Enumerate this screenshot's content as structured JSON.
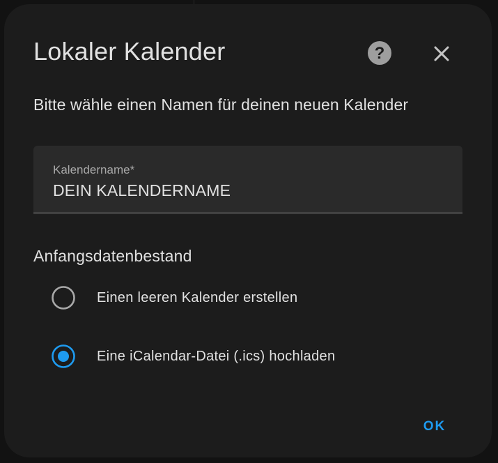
{
  "dialog": {
    "title": "Lokaler Kalender",
    "subtitle": "Bitte wähle einen Namen für deinen neuen Kalender",
    "help_icon": "help-circle-icon",
    "close_icon": "close-icon"
  },
  "name_field": {
    "label": "Kalendername*",
    "value": "DEIN KALENDERNAME"
  },
  "initial_data": {
    "title": "Anfangsdatenbestand",
    "options": [
      {
        "label": "Einen leeren Kalender erstellen",
        "selected": false
      },
      {
        "label": "Eine iCalendar-Datei (.ics) hochladen",
        "selected": true
      }
    ]
  },
  "actions": {
    "ok_label": "OK"
  },
  "colors": {
    "accent": "#1e9bf0",
    "dialog_bg": "#1c1c1c",
    "field_bg": "#2a2a2a",
    "text": "#e1e1e1"
  }
}
